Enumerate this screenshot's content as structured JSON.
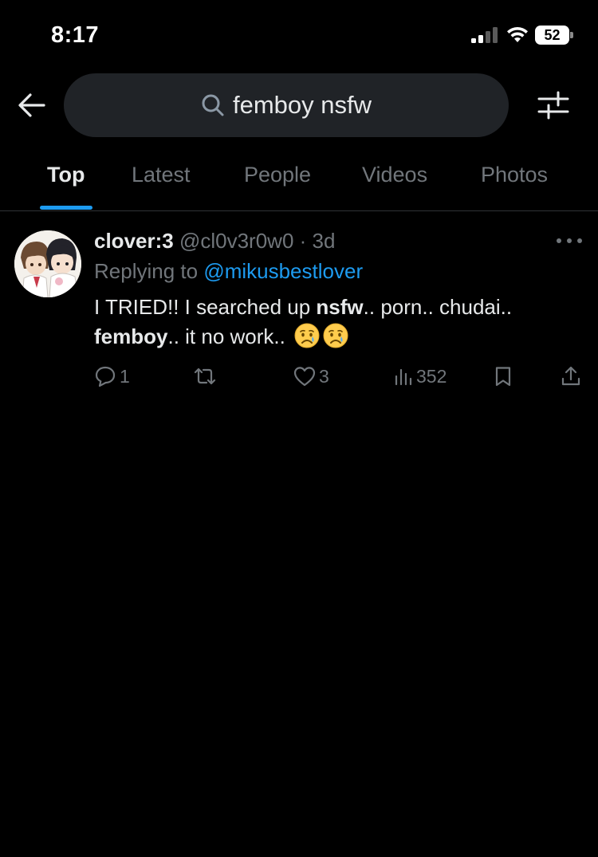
{
  "status_bar": {
    "time": "8:17",
    "battery": "52"
  },
  "search": {
    "query": "femboy nsfw"
  },
  "tabs": [
    {
      "label": "Top",
      "active": true
    },
    {
      "label": "Latest"
    },
    {
      "label": "People"
    },
    {
      "label": "Videos"
    },
    {
      "label": "Photos"
    }
  ],
  "tweet": {
    "display_name": "clover:3",
    "handle": "@cl0v3r0w0",
    "separator": " · ",
    "time": "3d",
    "replying_prefix": "Replying to ",
    "replying_to": "@mikusbestlover",
    "text_parts": [
      {
        "text": "I TRIED!! I searched up ",
        "bold": false
      },
      {
        "text": "nsfw",
        "bold": true
      },
      {
        "text": ".. porn.. chudai.. ",
        "bold": false
      },
      {
        "text": "femboy",
        "bold": true
      },
      {
        "text": ".. it no work..",
        "bold": false
      }
    ],
    "emoji": [
      "crying-face",
      "crying-face"
    ],
    "replies": "1",
    "retweets": "",
    "likes": "3",
    "views": "352"
  },
  "colors": {
    "background": "#000000",
    "text": "#e7e9ea",
    "muted": "#71767b",
    "accent": "#1d9bf0",
    "search_bg": "#202327"
  }
}
